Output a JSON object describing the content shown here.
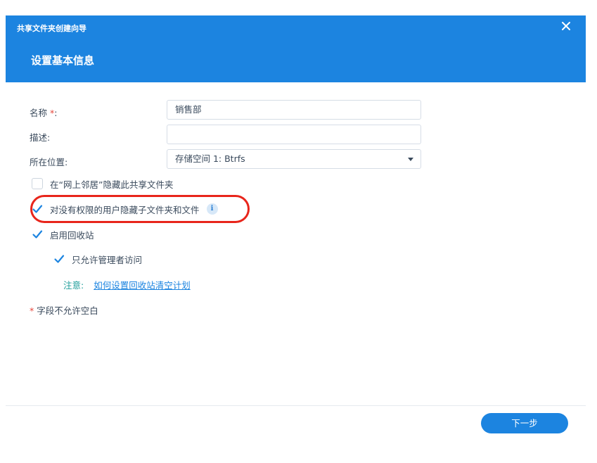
{
  "dialog": {
    "wizard_title": "共享文件夹创建向导",
    "step_title": "设置基本信息",
    "close_icon": "close-icon"
  },
  "form": {
    "name": {
      "label": "名称",
      "required_mark": "*",
      "colon": ":",
      "value": "销售部"
    },
    "description": {
      "label": "描述:",
      "value": ""
    },
    "location": {
      "label": "所在位置:",
      "selected_value": "存储空间 1:  Btrfs",
      "dropdown_icon": "chevron-down-icon"
    }
  },
  "options": [
    {
      "label": "在“网上邻居”隐藏此共享文件夹",
      "checked": false
    },
    {
      "label": "对没有权限的用户隐藏子文件夹和文件",
      "checked": true,
      "has_info_icon": true,
      "highlighted": true
    },
    {
      "label": "启用回收站",
      "checked": true
    },
    {
      "label": "只允许管理者访问",
      "checked": true
    }
  ],
  "info_icon_glyph": "i",
  "note": {
    "label": "注意:",
    "link_text": "如何设置回收站清空计划"
  },
  "required_hint": {
    "star": "*",
    "text": " 字段不允许空白"
  },
  "footer": {
    "next_label": "下一步"
  },
  "colors": {
    "accent": "#1c84e0",
    "required": "#e6453a",
    "highlight": "#e8251b",
    "note": "#1f9e9a"
  }
}
